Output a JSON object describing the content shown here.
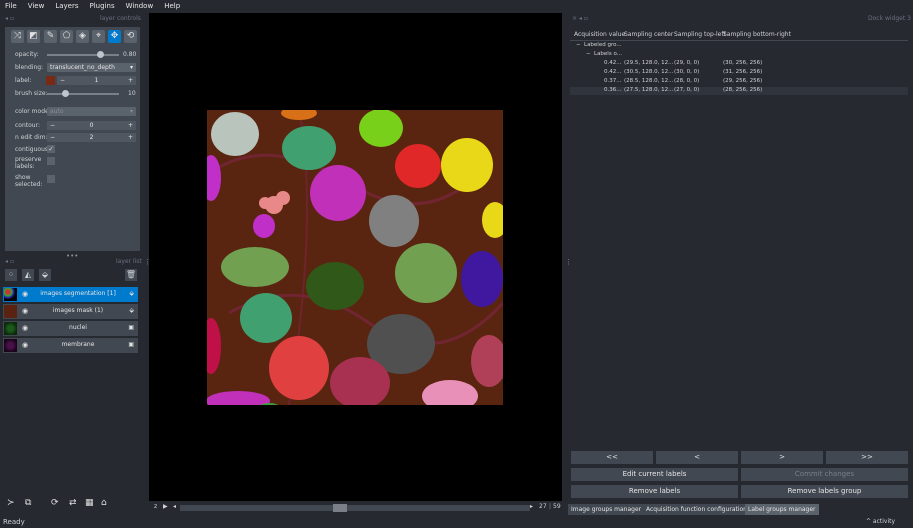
{
  "menu": [
    "File",
    "View",
    "Layers",
    "Plugins",
    "Window",
    "Help"
  ],
  "layer_controls": {
    "title": "layer controls",
    "opacity_label": "opacity:",
    "opacity_value": "0.80",
    "opacity_fraction": 0.8,
    "blending_label": "blending:",
    "blending_value": "translucent_no_depth",
    "label_label": "label:",
    "label_value": "1",
    "label_color": "#7a2a12",
    "brush_label": "brush size:",
    "brush_value": "10",
    "brush_fraction": 0.25,
    "colormode_label": "color mode:",
    "colormode_value": "auto",
    "contour_label": "contour:",
    "contour_value": "0",
    "ndim_label": "n edit dim:",
    "ndim_value": "2",
    "contiguous_label": "contiguous:",
    "preserve_label": "preserve\nlabels:",
    "show_label": "show\nselected:",
    "minus": "−",
    "plus": "+"
  },
  "layer_list": {
    "title": "layer list",
    "layers": [
      {
        "name": "images segmentation [1]",
        "selected": true
      },
      {
        "name": "images mask (1)",
        "selected": false
      },
      {
        "name": "nuclei",
        "selected": false
      },
      {
        "name": "membrane",
        "selected": false
      }
    ]
  },
  "dims": {
    "axis": "z",
    "current": "27",
    "total": "59"
  },
  "dock": {
    "title": "Dock widget 3",
    "headers": [
      "Acquisition value",
      "Sampling center",
      "Sampling top-left",
      "Sampling bottom-right"
    ],
    "group": "Labeled gro...",
    "subgroup": "Labels o...",
    "rows": [
      [
        "0.42...",
        "(29.5, 128.0, 12...",
        "(29, 0, 0)",
        "(30, 256, 256)"
      ],
      [
        "0.42...",
        "(30.5, 128.0, 12...",
        "(30, 0, 0)",
        "(31, 256, 256)"
      ],
      [
        "0.37...",
        "(28.5, 128.0, 12...",
        "(28, 0, 0)",
        "(29, 256, 256)"
      ],
      [
        "0.36...",
        "(27.5, 128.0, 12...",
        "(27, 0, 0)",
        "(28, 256, 256)"
      ]
    ],
    "nav": [
      "<<",
      "<",
      ">",
      ">>"
    ],
    "edit": "Edit current labels",
    "commit": "Commit changes",
    "remove": "Remove labels",
    "remove_group": "Remove labels group"
  },
  "tabs": [
    "Image groups manager",
    "Acquisition function configuration",
    "Label groups manager"
  ],
  "status": {
    "text": "Ready",
    "activity": "^ activity"
  }
}
